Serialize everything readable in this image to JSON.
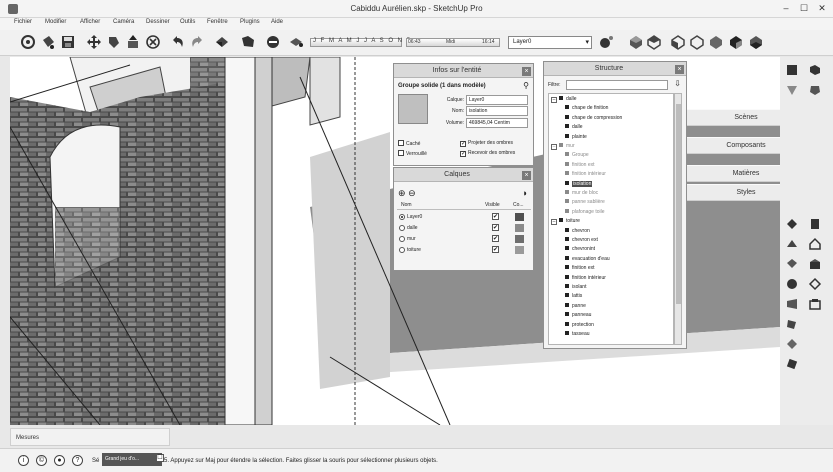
{
  "window": {
    "title": "Cabiddu Aurélien.skp - SketchUp Pro",
    "controls": {
      "minimize": "–",
      "maximize": "☐",
      "close": "✕"
    }
  },
  "menu": [
    "Fichier",
    "Modifier",
    "Afficher",
    "Caméra",
    "Dessiner",
    "Outils",
    "Fenêtre",
    "Plugins",
    "Aide"
  ],
  "toolbar": {
    "shadow_months": "J F M A M J J A S O N D",
    "time_start": "06:43",
    "time_mid": "Midi",
    "time_end": "16:14",
    "layer_value": "Layer0",
    "icons": [
      "orbit-icon",
      "paint-bucket-icon",
      "save-icon",
      "move-icon",
      "paint-icon",
      "push-pull-icon",
      "erase-icon",
      "undo-icon",
      "redo-icon",
      "zoom-extents-icon",
      "camera-icon",
      "section-icon",
      "component-icon"
    ]
  },
  "entity_info": {
    "title": "Infos sur l'entité",
    "group_name": "Groupe solide (1 dans modèle)",
    "layer_label": "Calque:",
    "layer_value": "Layer0",
    "name_label": "Nom:",
    "name_value": "isolation",
    "volume_label": "Volume:",
    "volume_value": "469845,04 Centim",
    "checkboxes": [
      {
        "label": "Caché",
        "checked": false
      },
      {
        "label": "Projeter des ombres",
        "checked": true
      },
      {
        "label": "Verrouillé",
        "checked": false
      },
      {
        "label": "Recevoir des ombres",
        "checked": true
      }
    ]
  },
  "calques": {
    "title": "Calques",
    "add": "⊕",
    "remove": "⊖",
    "header_name": "Nom",
    "header_visible": "Visible",
    "header_color": "Co...",
    "rows": [
      {
        "name": "Layer0",
        "active": true,
        "visible": "✔",
        "color": "#4f4f4f"
      },
      {
        "name": "dalle",
        "active": false,
        "visible": "✔",
        "color": "#8a8a8a"
      },
      {
        "name": "mur",
        "active": false,
        "visible": "✔",
        "color": "#6e6e6e"
      },
      {
        "name": "toiture",
        "active": false,
        "visible": "✔",
        "color": "#9a9a9a"
      }
    ]
  },
  "structure": {
    "title": "Structure",
    "filter_label": "Filtre:",
    "tree": [
      {
        "label": "dalle",
        "depth": 1,
        "toggle": "–",
        "kind": "root"
      },
      {
        "label": "chape de finition",
        "depth": 2
      },
      {
        "label": "chape de compression",
        "depth": 2
      },
      {
        "label": "dalle",
        "depth": 2
      },
      {
        "label": "plainte",
        "depth": 2
      },
      {
        "label": "mur",
        "depth": 1,
        "toggle": "–",
        "kind": "root",
        "dim": true
      },
      {
        "label": "Groupe",
        "depth": 2,
        "dim": true
      },
      {
        "label": "finition ext",
        "depth": 2,
        "dim": true
      },
      {
        "label": "finition intérieur",
        "depth": 2,
        "dim": true
      },
      {
        "label": "isolation",
        "depth": 2,
        "selected": true
      },
      {
        "label": "mur de bloc",
        "depth": 2,
        "dim": true
      },
      {
        "label": "panne sablière",
        "depth": 2,
        "dim": true
      },
      {
        "label": "plafonage toile",
        "depth": 2,
        "dim": true
      },
      {
        "label": "toiture",
        "depth": 1,
        "toggle": "–",
        "kind": "root"
      },
      {
        "label": "chevron",
        "depth": 2
      },
      {
        "label": "chevron ext",
        "depth": 2
      },
      {
        "label": "chevronint",
        "depth": 2
      },
      {
        "label": "evacuation d'eau",
        "depth": 2
      },
      {
        "label": "finition ext",
        "depth": 2
      },
      {
        "label": "finition intérieur",
        "depth": 2
      },
      {
        "label": "isolant",
        "depth": 2
      },
      {
        "label": "lattis",
        "depth": 2
      },
      {
        "label": "panne",
        "depth": 2
      },
      {
        "label": "panneau",
        "depth": 2
      },
      {
        "label": "protection",
        "depth": 2
      },
      {
        "label": "tasseau",
        "depth": 2
      }
    ]
  },
  "tray": [
    "Scènes",
    "Composants",
    "Matières",
    "Styles"
  ],
  "status": {
    "measures_label": "Mesures",
    "sel_prefix": "Sé",
    "task_label": "Grand jeu d'o...",
    "task_close": "☐",
    "hint": "5. Appuyez sur Maj pour étendre la sélection. Faites glisser la souris pour sélectionner plusieurs objets."
  }
}
